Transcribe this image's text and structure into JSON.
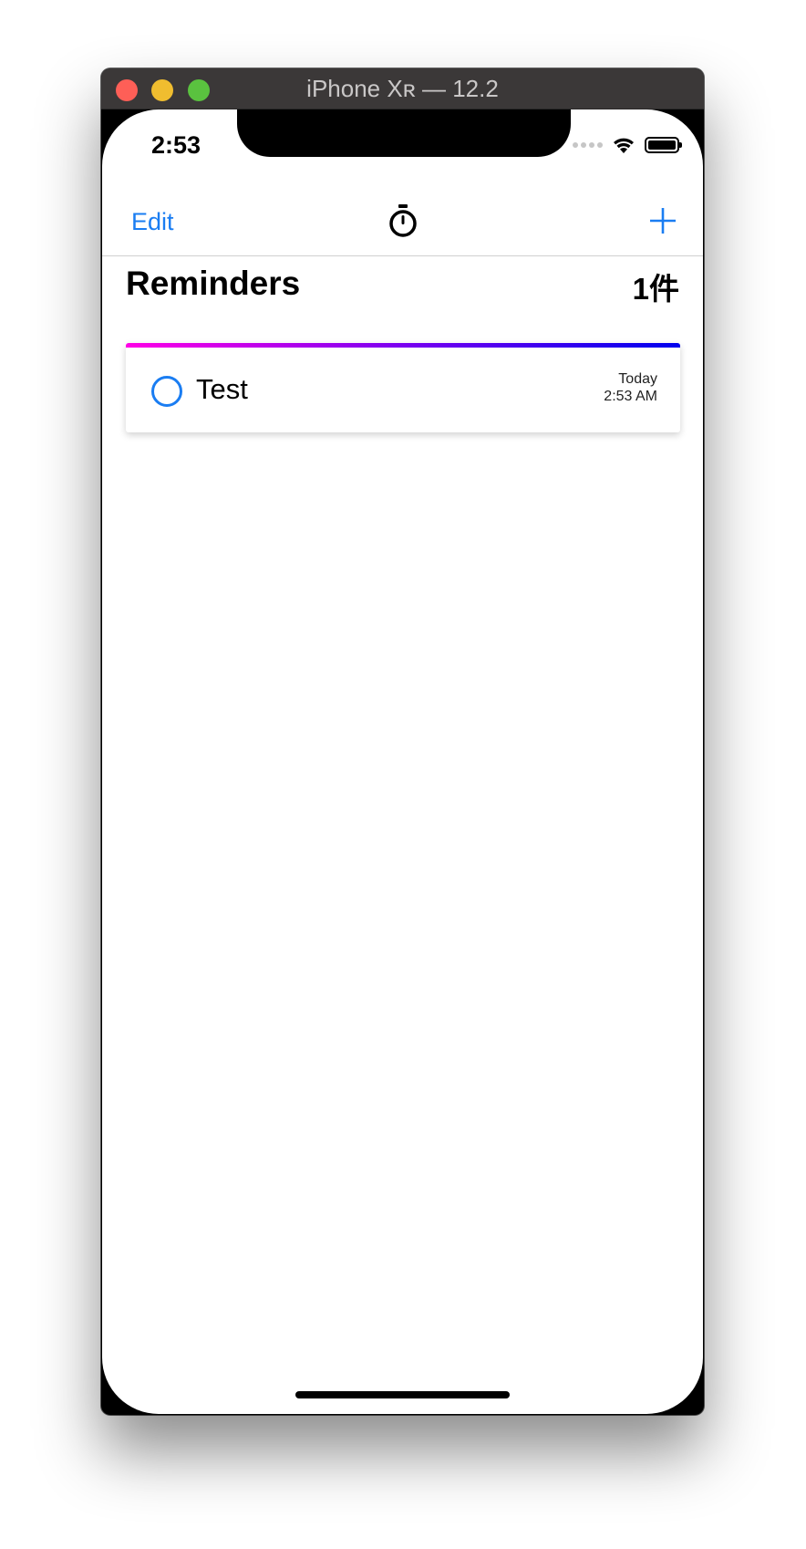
{
  "window": {
    "title": "iPhone Xʀ — 12.2"
  },
  "status_bar": {
    "time": "2:53",
    "icons": [
      "cellular-signal-icon",
      "wifi-icon",
      "battery-icon"
    ]
  },
  "navbar": {
    "edit_label": "Edit",
    "center_icon": "stopwatch-icon",
    "add_icon": "plus-icon"
  },
  "list": {
    "title": "Reminders",
    "count": "1件",
    "items": [
      {
        "title": "Test",
        "date": "Today",
        "time": "2:53 AM",
        "completed": false
      }
    ]
  },
  "colors": {
    "accent": "#1a7df2",
    "gradient_start": "#ff00e6",
    "gradient_end": "#0000ee"
  }
}
